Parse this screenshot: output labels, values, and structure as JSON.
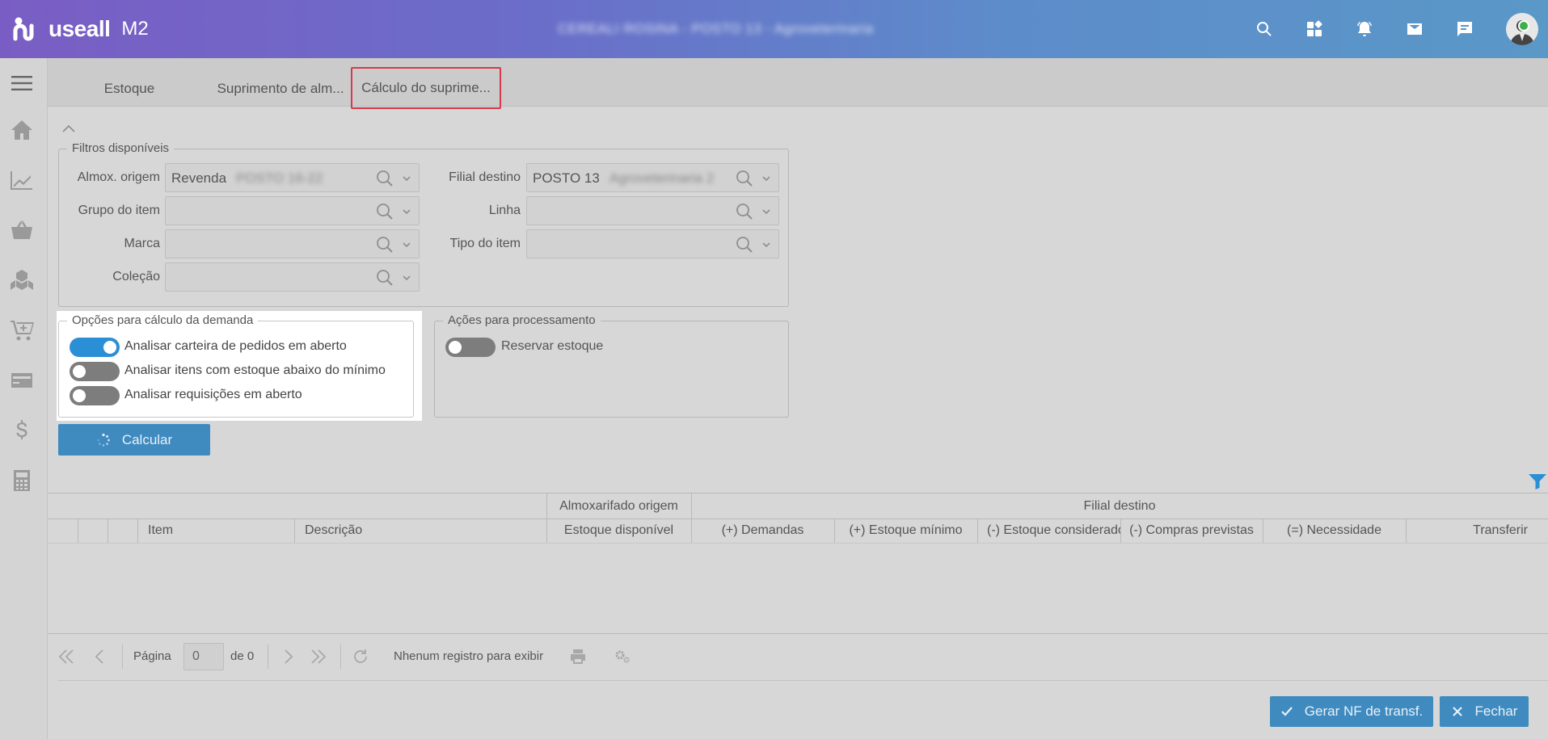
{
  "app": {
    "logo_text": "useall",
    "logo_suffix": "M2",
    "context_text": "CEREALI ROSINA - POSTO 13 - Agroveterinaria"
  },
  "tabs": [
    {
      "label": "Estoque"
    },
    {
      "label": "Suprimento de alm..."
    },
    {
      "label": "Cálculo do suprime..."
    }
  ],
  "filters": {
    "legend": "Filtros disponíveis",
    "almox_origem": {
      "label": "Almox. origem",
      "value": "Revenda",
      "blurred": "POSTO 16-22"
    },
    "filial_destino": {
      "label": "Filial destino",
      "value": "POSTO 13",
      "blurred": "Agroveterinaria 2"
    },
    "grupo_item": {
      "label": "Grupo do item",
      "value": ""
    },
    "linha": {
      "label": "Linha",
      "value": ""
    },
    "marca": {
      "label": "Marca",
      "value": ""
    },
    "tipo_item": {
      "label": "Tipo do item",
      "value": ""
    },
    "colecao": {
      "label": "Coleção",
      "value": ""
    }
  },
  "demand_options": {
    "legend": "Opções para cálculo da demanda",
    "items": [
      {
        "label": "Analisar carteira de pedidos em aberto",
        "on": true
      },
      {
        "label": "Analisar itens com estoque abaixo do mínimo",
        "on": false
      },
      {
        "label": "Analisar requisições em aberto",
        "on": false
      }
    ]
  },
  "process_actions": {
    "legend": "Ações para processamento",
    "items": [
      {
        "label": "Reservar estoque",
        "on": false
      }
    ]
  },
  "calc_button": "Calcular",
  "grid": {
    "group_headers": {
      "almox": "Almoxarifado origem",
      "filial": "Filial destino"
    },
    "columns": [
      "Item",
      "Descrição",
      "Estoque disponível",
      "(+) Demandas",
      "(+) Estoque mínimo",
      "(-) Estoque considerado",
      "(-) Compras previstas",
      "(=) Necessidade",
      "Transferir"
    ]
  },
  "pager": {
    "page_label": "Página",
    "page_value": "0",
    "of_label": "de 0",
    "empty_text": "Nhenum registro para exibir"
  },
  "buttons": {
    "generate": "Gerar NF de transf.",
    "close": "Fechar"
  },
  "colors": {
    "accent": "#3f8bc0",
    "toggle_on": "#2b8fd6",
    "active_tab_border": "#d6384c"
  }
}
